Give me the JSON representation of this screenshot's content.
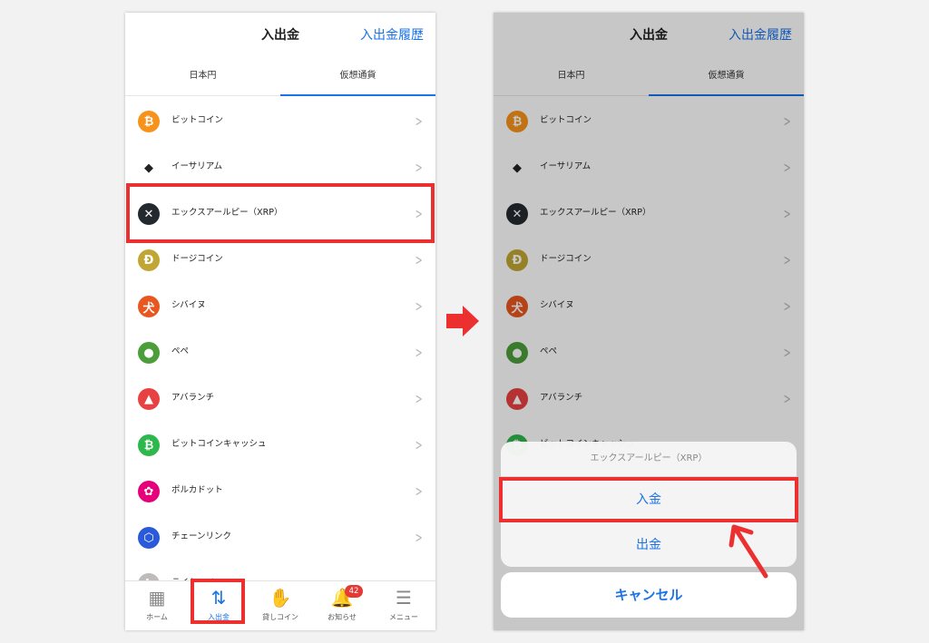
{
  "left_screen": {
    "header": {
      "title": "入出金",
      "history_link": "入出金履歴"
    },
    "tabs": [
      {
        "label": "日本円"
      },
      {
        "label": "仮想通貨"
      }
    ],
    "coins": [
      {
        "label": "ビットコイン",
        "icon": "bitcoin-icon",
        "color": "#f7931a",
        "glyph": "₿"
      },
      {
        "label": "イーサリアム",
        "icon": "ethereum-icon",
        "color": "#ffffff",
        "glyph": "◆"
      },
      {
        "label": "エックスアールピー（XRP）",
        "icon": "xrp-icon",
        "color": "#23292f",
        "glyph": "✕"
      },
      {
        "label": "ドージコイン",
        "icon": "dogecoin-icon",
        "color": "#c2a633",
        "glyph": "Ð"
      },
      {
        "label": "シバイヌ",
        "icon": "shiba-inu-icon",
        "color": "#e8571f",
        "glyph": "犬"
      },
      {
        "label": "ペペ",
        "icon": "pepe-icon",
        "color": "#4c9e3a",
        "glyph": "●"
      },
      {
        "label": "アバランチ",
        "icon": "avalanche-icon",
        "color": "#e84142",
        "glyph": "▲"
      },
      {
        "label": "ビットコインキャッシュ",
        "icon": "bitcoin-cash-icon",
        "color": "#2db84b",
        "glyph": "₿"
      },
      {
        "label": "ポルカドット",
        "icon": "polkadot-icon",
        "color": "#e6007a",
        "glyph": "✿"
      },
      {
        "label": "チェーンリンク",
        "icon": "chainlink-icon",
        "color": "#2a5ada",
        "glyph": "⬡"
      },
      {
        "label": "ライトコイン",
        "icon": "litecoin-icon",
        "color": "#bfbbbb",
        "glyph": "Ł"
      }
    ],
    "nav": [
      {
        "label": "ホーム",
        "icon": "home-grid-icon",
        "glyph": "▦"
      },
      {
        "label": "入出金",
        "icon": "transfer-arrows-icon",
        "glyph": "⇅"
      },
      {
        "label": "貸しコイン",
        "icon": "lending-coin-icon",
        "glyph": "✋"
      },
      {
        "label": "お知らせ",
        "icon": "bell-icon",
        "glyph": "🔔",
        "badge": "42"
      },
      {
        "label": "メニュー",
        "icon": "hamburger-menu-icon",
        "glyph": "☰"
      }
    ]
  },
  "right_screen": {
    "header": {
      "title": "入出金",
      "history_link": "入出金履歴"
    },
    "tabs": [
      {
        "label": "日本円"
      },
      {
        "label": "仮想通貨"
      }
    ],
    "coins": [
      {
        "label": "ビットコイン",
        "icon": "bitcoin-icon",
        "color": "#f7931a",
        "glyph": "₿"
      },
      {
        "label": "イーサリアム",
        "icon": "ethereum-icon",
        "color": "#ffffff",
        "glyph": "◆"
      },
      {
        "label": "エックスアールピー（XRP）",
        "icon": "xrp-icon",
        "color": "#23292f",
        "glyph": "✕"
      },
      {
        "label": "ドージコイン",
        "icon": "dogecoin-icon",
        "color": "#c2a633",
        "glyph": "Ð"
      },
      {
        "label": "シバイヌ",
        "icon": "shiba-inu-icon",
        "color": "#e8571f",
        "glyph": "犬"
      },
      {
        "label": "ペペ",
        "icon": "pepe-icon",
        "color": "#4c9e3a",
        "glyph": "●"
      },
      {
        "label": "アバランチ",
        "icon": "avalanche-icon",
        "color": "#e84142",
        "glyph": "▲"
      },
      {
        "label": "ビットコインキャッシュ",
        "icon": "bitcoin-cash-icon",
        "color": "#2db84b",
        "glyph": "₿"
      }
    ],
    "action_sheet": {
      "title": "エックスアールピー（XRP）",
      "deposit_label": "入金",
      "withdraw_label": "出金",
      "cancel_label": "キャンセル"
    }
  },
  "colors": {
    "accent": "#1a73e8",
    "highlight": "#ec2f2f",
    "chevron": "#b5b5b5"
  }
}
